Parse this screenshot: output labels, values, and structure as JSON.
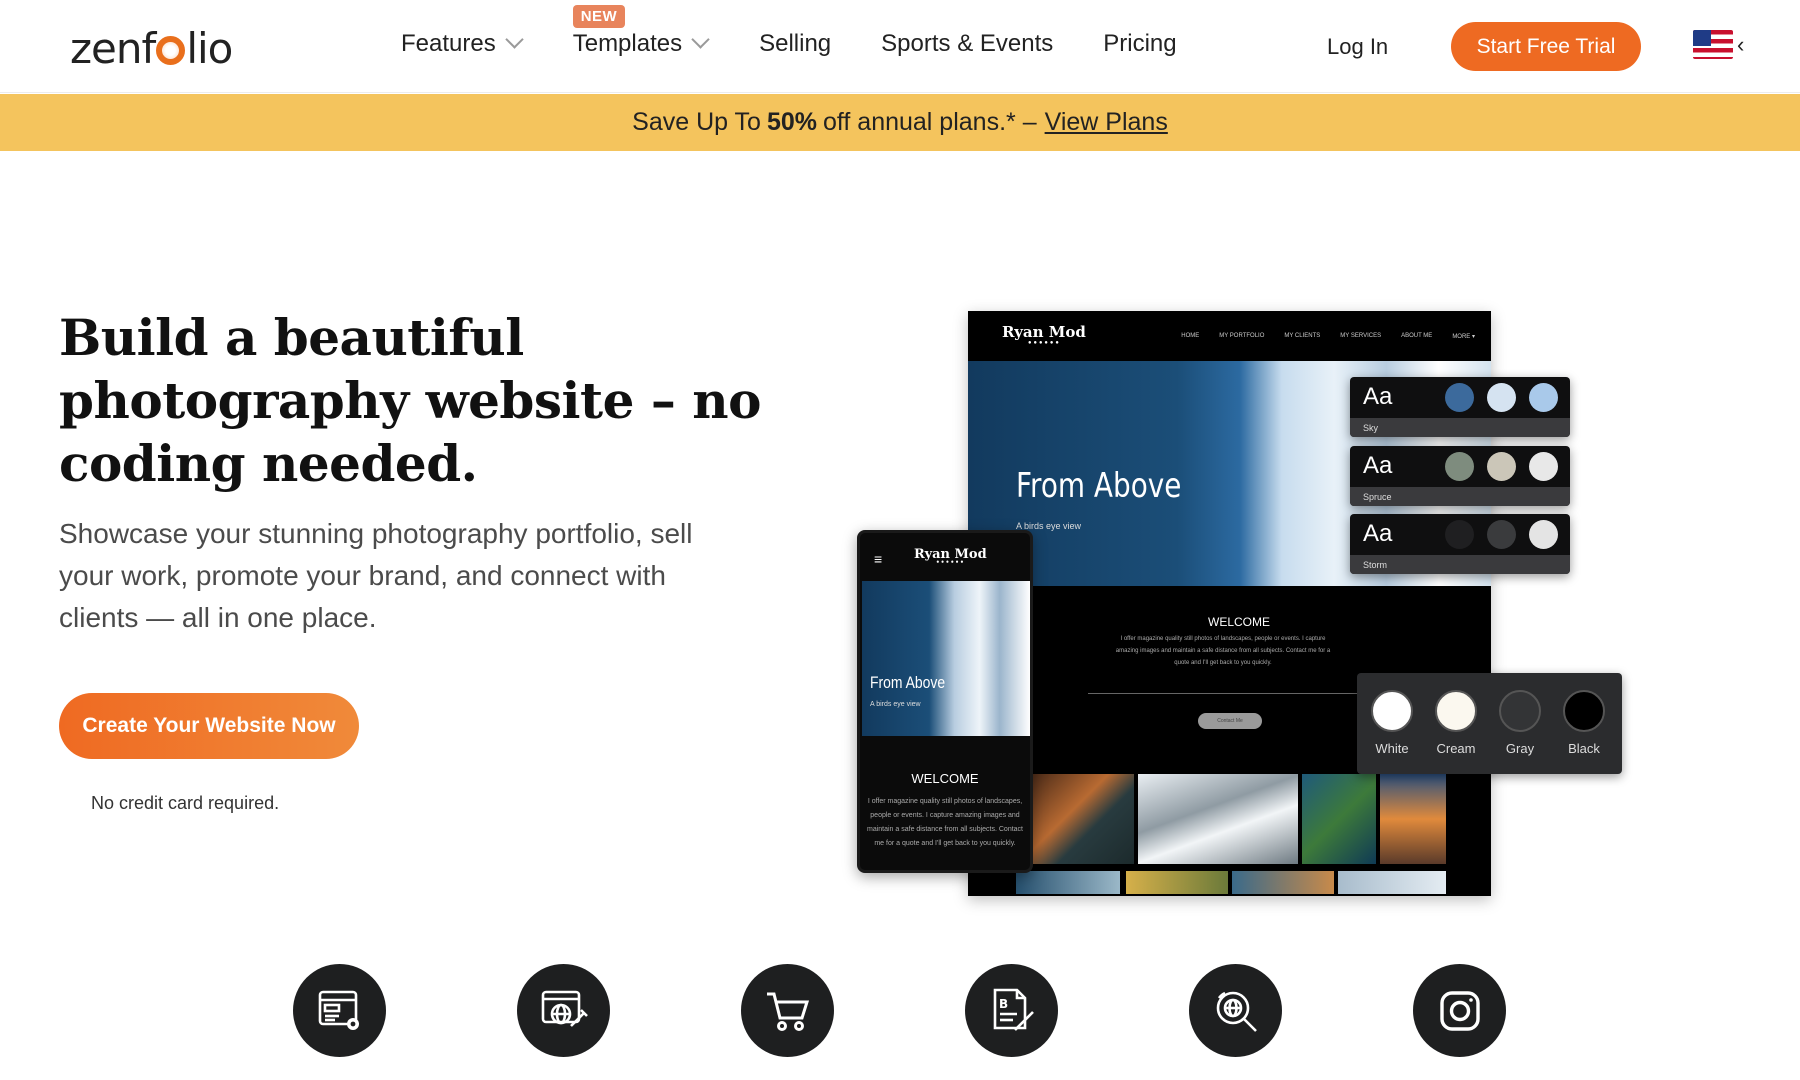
{
  "nav": {
    "logo": {
      "part1": "zen",
      "part2": "f",
      "part3": "lio"
    },
    "items": [
      {
        "label": "Features"
      },
      {
        "label": "Templates",
        "badge": "NEW"
      },
      {
        "label": "Selling"
      },
      {
        "label": "Sports & Events"
      },
      {
        "label": "Pricing"
      }
    ],
    "login": "Log In",
    "trial": "Start Free Trial",
    "flag_caret": "‹"
  },
  "promo": {
    "prefix": "Save Up To",
    "bold": "50%",
    "suffix": "off annual plans.* –",
    "link": "View Plans"
  },
  "hero": {
    "heading": "Build a beautiful photography website – no coding needed.",
    "lead": "Showcase your stunning photography portfolio, sell your work, promote your brand, and connect with clients — all in one place.",
    "cta": "Create Your Website Now",
    "note": "No credit card required."
  },
  "mockup": {
    "brand": "Ryan Mod",
    "links": [
      "HOME",
      "MY PORTFOLIO",
      "MY CLIENTS",
      "MY SERVICES",
      "ABOUT ME",
      "MORE ▾"
    ],
    "hero_title": "From Above",
    "hero_sub": "A birds eye view",
    "welcome": "WELCOME",
    "copy": "I offer magazine quality still photos of landscapes, people or events. I capture amazing images and maintain a safe distance from all subjects. Contact me for a quote and I'll get back to you quickly.",
    "contact_btn": "Contact Me",
    "phone_menu": "≡",
    "themes": [
      {
        "aa": "Aa",
        "name": "Sky",
        "colors": [
          "#3c6a9c",
          "#d5e3f1",
          "#a9c9ea"
        ]
      },
      {
        "aa": "Aa",
        "name": "Spruce",
        "colors": [
          "#7e8c7e",
          "#cbc6b8",
          "#e8e8e8"
        ]
      },
      {
        "aa": "Aa",
        "name": "Storm",
        "colors": [
          "#1f1f21",
          "#3a3b3d",
          "#e4e4e4"
        ]
      }
    ],
    "swatches": [
      {
        "label": "White",
        "color": "#ffffff"
      },
      {
        "label": "Cream",
        "color": "#fbf8ef"
      },
      {
        "label": "Gray",
        "color": "#333436"
      },
      {
        "label": "Black",
        "color": "#000000"
      }
    ]
  },
  "features": [
    {
      "icon": "website-settings-icon"
    },
    {
      "icon": "web-design-icon"
    },
    {
      "icon": "shopping-cart-icon"
    },
    {
      "icon": "blog-edit-icon"
    },
    {
      "icon": "seo-search-icon"
    },
    {
      "icon": "instagram-icon"
    }
  ],
  "colors": {
    "accent": "#ee6a22",
    "promo_bg": "#f4c45d",
    "badge": "#e8845c"
  }
}
